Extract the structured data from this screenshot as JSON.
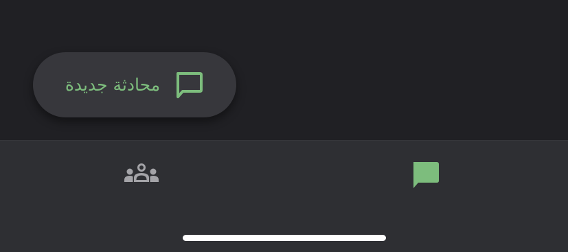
{
  "fab": {
    "label": "محادثة جديدة",
    "icon": "chat-bubble-outline-icon"
  },
  "bottom_nav": {
    "tabs": [
      {
        "id": "people",
        "icon": "people-group-icon",
        "active": false
      },
      {
        "id": "chats",
        "icon": "chat-bubble-filled-icon",
        "active": true
      }
    ]
  },
  "colors": {
    "background": "#202024",
    "fab_background": "#37373c",
    "accent_green": "#7dbd7d",
    "nav_background": "#2e2f33",
    "inactive_icon": "#a4a4a8",
    "home_indicator": "#ffffff"
  }
}
